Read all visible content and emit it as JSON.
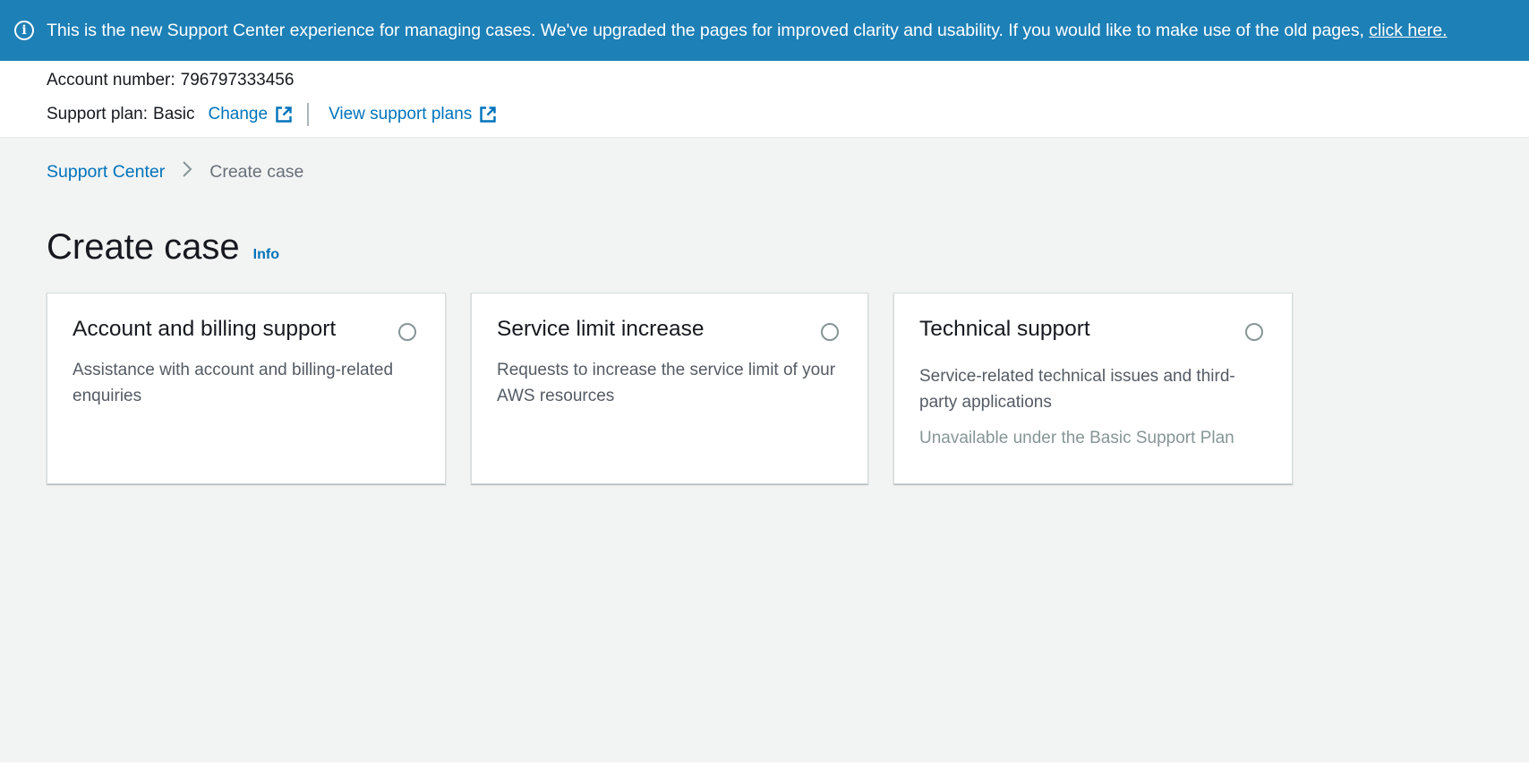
{
  "flashbar": {
    "icon": "info-icon",
    "message": "This is the new Support Center experience for managing cases. We've upgraded the pages for improved clarity and usability. If you would like to make use of the old pages, ",
    "link_label": "click here.",
    "background_color": "#1d80b7"
  },
  "account": {
    "number_label": "Account number:",
    "number_value": "796797333456",
    "plan_label": "Support plan:",
    "plan_value": "Basic",
    "change_label": "Change",
    "view_plans_label": "View support plans",
    "external_link_icon": "external-link-icon"
  },
  "breadcrumb": {
    "items": [
      {
        "label": "Support Center"
      },
      {
        "label": "Create case"
      }
    ]
  },
  "page": {
    "title": "Create case",
    "info_label": "Info"
  },
  "tiles": [
    {
      "title": "Account and billing support",
      "description": "Assistance with account and billing-related enquiries",
      "note": ""
    },
    {
      "title": "Service limit increase",
      "description": "Requests to increase the service limit of your AWS resources",
      "note": ""
    },
    {
      "title": "Technical support",
      "description": "Service-related technical issues and third-party applications",
      "note": "Unavailable under the Basic Support Plan"
    }
  ],
  "colors": {
    "link": "#0073bb",
    "page_background": "#f2f3f3"
  }
}
